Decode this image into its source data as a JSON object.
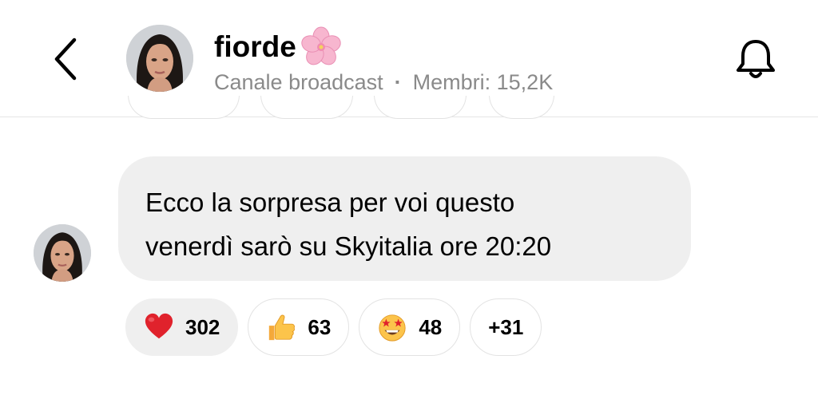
{
  "header": {
    "channel_name": "fiorde",
    "channel_type": "Canale broadcast",
    "separator": "·",
    "members": "Membri: 15,2K",
    "icons": {
      "back": "chevron-left-icon",
      "bell": "bell-icon",
      "flower": "cherry-blossom-emoji"
    }
  },
  "message": {
    "text": "Ecco la sorpresa per voi questo\nvenerdì sarò su Skyitalia ore 20:20"
  },
  "reactions": [
    {
      "emoji": "red-heart",
      "count": "302",
      "active": true
    },
    {
      "emoji": "thumbs-up",
      "count": "63",
      "active": false
    },
    {
      "emoji": "star-struck",
      "count": "48",
      "active": false
    },
    {
      "emoji": "",
      "count": "+31",
      "active": false
    }
  ],
  "colors": {
    "bubble": "#efefef",
    "subtext": "#8a8a8a",
    "divider": "#e6e6e6"
  }
}
